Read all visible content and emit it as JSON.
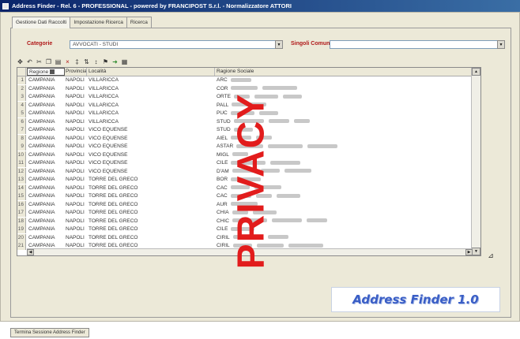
{
  "window": {
    "title": "Address Finder - Rel. 6 - PROFESSIONAL - powered by FRANCIPOST S.r.l. - Normalizzatore ATTORI"
  },
  "tabs": [
    {
      "label": "Gestione Dati Raccolti",
      "active": true
    },
    {
      "label": "Impostazione Ricerca",
      "active": false
    },
    {
      "label": "Ricerca",
      "active": false
    }
  ],
  "filters": {
    "category_label": "Categorie",
    "category_value": "AVVOCATI - STUDI",
    "municipality_label": "Singoli Comuni",
    "municipality_value": ""
  },
  "toolbar": {
    "icons": [
      "move-icon",
      "undo-icon",
      "cut-icon",
      "copy-icon",
      "paste-icon",
      "delete-icon",
      "find-icon",
      "sort-asc-icon",
      "sort-desc-icon",
      "filter-icon",
      "export-icon",
      "grid-icon"
    ]
  },
  "grid": {
    "columns": [
      "Regione",
      "Provincia",
      "Località",
      "Ragione Sociale"
    ],
    "rows": [
      {
        "n": "1",
        "regione": "CAMPANIA",
        "prov": "NAPOLI",
        "loc": "VILLARICCA",
        "rs": "ARC"
      },
      {
        "n": "2",
        "regione": "CAMPANIA",
        "prov": "NAPOLI",
        "loc": "VILLARICCA",
        "rs": "COR"
      },
      {
        "n": "3",
        "regione": "CAMPANIA",
        "prov": "NAPOLI",
        "loc": "VILLARICCA",
        "rs": "ORTE"
      },
      {
        "n": "4",
        "regione": "CAMPANIA",
        "prov": "NAPOLI",
        "loc": "VILLARICCA",
        "rs": "PALL"
      },
      {
        "n": "5",
        "regione": "CAMPANIA",
        "prov": "NAPOLI",
        "loc": "VILLARICCA",
        "rs": "PUC"
      },
      {
        "n": "6",
        "regione": "CAMPANIA",
        "prov": "NAPOLI",
        "loc": "VILLARICCA",
        "rs": "STUD"
      },
      {
        "n": "7",
        "regione": "CAMPANIA",
        "prov": "NAPOLI",
        "loc": "VICO EQUENSE",
        "rs": "STUD"
      },
      {
        "n": "8",
        "regione": "CAMPANIA",
        "prov": "NAPOLI",
        "loc": "VICO EQUENSE",
        "rs": "AIEL"
      },
      {
        "n": "9",
        "regione": "CAMPANIA",
        "prov": "NAPOLI",
        "loc": "VICO EQUENSE",
        "rs": "ASTAR"
      },
      {
        "n": "10",
        "regione": "CAMPANIA",
        "prov": "NAPOLI",
        "loc": "VICO EQUENSE",
        "rs": "MIGL"
      },
      {
        "n": "11",
        "regione": "CAMPANIA",
        "prov": "NAPOLI",
        "loc": "VICO EQUENSE",
        "rs": "CILE"
      },
      {
        "n": "12",
        "regione": "CAMPANIA",
        "prov": "NAPOLI",
        "loc": "VICO EQUENSE",
        "rs": "D'AM"
      },
      {
        "n": "13",
        "regione": "CAMPANIA",
        "prov": "NAPOLI",
        "loc": "TORRE DEL GRECO",
        "rs": "BOR"
      },
      {
        "n": "14",
        "regione": "CAMPANIA",
        "prov": "NAPOLI",
        "loc": "TORRE DEL GRECO",
        "rs": "CAC"
      },
      {
        "n": "15",
        "regione": "CAMPANIA",
        "prov": "NAPOLI",
        "loc": "TORRE DEL GRECO",
        "rs": "CAC"
      },
      {
        "n": "16",
        "regione": "CAMPANIA",
        "prov": "NAPOLI",
        "loc": "TORRE DEL GRECO",
        "rs": "AUR"
      },
      {
        "n": "17",
        "regione": "CAMPANIA",
        "prov": "NAPOLI",
        "loc": "TORRE DEL GRECO",
        "rs": "CHIA"
      },
      {
        "n": "18",
        "regione": "CAMPANIA",
        "prov": "NAPOLI",
        "loc": "TORRE DEL GRECO",
        "rs": "CHIC"
      },
      {
        "n": "19",
        "regione": "CAMPANIA",
        "prov": "NAPOLI",
        "loc": "TORRE DEL GRECO",
        "rs": "CILE"
      },
      {
        "n": "20",
        "regione": "CAMPANIA",
        "prov": "NAPOLI",
        "loc": "TORRE DEL GRECO",
        "rs": "CIRIL"
      },
      {
        "n": "21",
        "regione": "CAMPANIA",
        "prov": "NAPOLI",
        "loc": "TORRE DEL GRECO",
        "rs": "CIRIL"
      }
    ]
  },
  "watermark": "PRIVACY",
  "logo": "Address Finder 1.0",
  "status_tab": "Termina Sessione Address Finder"
}
